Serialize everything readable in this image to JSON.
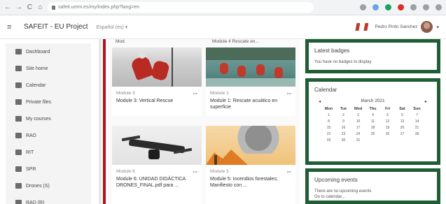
{
  "browser": {
    "url": "safeit.umm.es/my/index.php?lang=en",
    "nav_back": "←",
    "nav_forward": "→",
    "nav_reload": "C",
    "nav_home": "⌂",
    "ext_colors": [
      "#9aa0a6",
      "#6aa3e8",
      "#1aa260",
      "#d93025",
      "#9aa0a6",
      "#9aa0a6",
      "#9aa0a6"
    ]
  },
  "header": {
    "menu_icon": "≡",
    "site_name": "SAFEIT - EU Project",
    "lang_label": "Español (es) ▾",
    "user_name": "Pedro Pinto Sanchez",
    "caret": "▾"
  },
  "sidebar": {
    "items": [
      {
        "label": "Dashboard",
        "icon": "dashboard-icon"
      },
      {
        "label": "Site home",
        "icon": "home-icon"
      },
      {
        "label": "Calendar",
        "icon": "calendar-icon"
      },
      {
        "label": "Private files",
        "icon": "file-icon"
      },
      {
        "label": "My courses",
        "icon": "graduation-cap-icon"
      },
      {
        "label": "RAD",
        "icon": "course-icon"
      },
      {
        "label": "RIT",
        "icon": "course-icon"
      },
      {
        "label": "SPR",
        "icon": "course-icon"
      },
      {
        "label": "Drones (S)",
        "icon": "course-icon"
      },
      {
        "label": "RAD (R)",
        "icon": "course-icon"
      }
    ]
  },
  "courses": {
    "fragment_left": "Mod.",
    "fragment_right": "Module 4 Rescate en...",
    "cards": [
      {
        "category": "Module 3",
        "menu": "⋯",
        "title": "Module 3: Vertical Rescue"
      },
      {
        "category": "Module 1",
        "menu": "⋯",
        "title": "Module 1: Rescate acuático en superficie"
      },
      {
        "category": "Module 6",
        "menu": "⋯",
        "title": "Module 6: UNIDAD DIDÁCTICA DRONES_FINAL.pdf para ..."
      },
      {
        "category": "Module 5",
        "menu": "⋯",
        "title": "Module 5: Incendios forestales; Manifiesto con ..."
      }
    ]
  },
  "blocks": {
    "badges": {
      "title": "Latest badges",
      "text": "You have no badges to display"
    },
    "calendar": {
      "title": "Calendar",
      "month": "March 2021",
      "prev": "◂",
      "next": "▸",
      "days_of_week": [
        "Mon",
        "Tue",
        "Wed",
        "Thu",
        "Fri",
        "Sat",
        "Sun"
      ],
      "days": [
        "1",
        "2",
        "3",
        "4",
        "5",
        "6",
        "7",
        "8",
        "9",
        "10",
        "11",
        "12",
        "13",
        "14",
        "15",
        "16",
        "17",
        "18",
        "19",
        "20",
        "21",
        "22",
        "23",
        "24",
        "25",
        "26",
        "27",
        "28",
        "29",
        "30",
        "31"
      ]
    },
    "upcoming": {
      "title": "Upcoming events",
      "text": "There are no upcoming events",
      "more": "Go to calendar..."
    }
  }
}
